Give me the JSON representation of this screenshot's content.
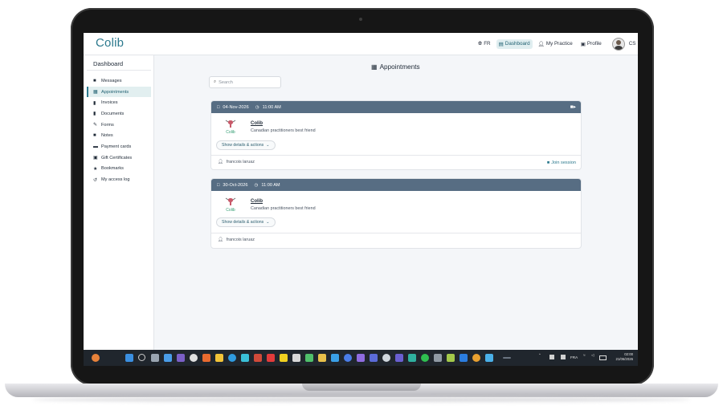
{
  "header": {
    "logo": "Colib",
    "language": "FR",
    "nav": [
      {
        "label": "Dashboard",
        "icon": "dashboard-icon",
        "active": true
      },
      {
        "label": "My Practice",
        "icon": "person-icon",
        "active": false
      },
      {
        "label": "Profile",
        "icon": "id-card-icon",
        "active": false
      }
    ],
    "user_initials": "CS"
  },
  "sidebar": {
    "title": "Dashboard",
    "items": [
      {
        "label": "Messages",
        "icon": "chat-icon"
      },
      {
        "label": "Appointments",
        "icon": "calendar-icon",
        "active": true
      },
      {
        "label": "Invoices",
        "icon": "file-icon"
      },
      {
        "label": "Documents",
        "icon": "document-icon"
      },
      {
        "label": "Forms",
        "icon": "form-icon"
      },
      {
        "label": "Notes",
        "icon": "note-icon"
      },
      {
        "label": "Payment cards",
        "icon": "credit-card-icon"
      },
      {
        "label": "Gift Certificates",
        "icon": "gift-icon"
      },
      {
        "label": "Bookmarks",
        "icon": "star-icon"
      },
      {
        "label": "My access log",
        "icon": "history-icon"
      }
    ]
  },
  "main": {
    "title": "Appointments",
    "search_placeholder": "Search",
    "appointments": [
      {
        "date": "04-Nov-2026",
        "time": "11:00 AM",
        "provider": "Colib",
        "provider_logo_text": "Colib",
        "subtitle": "Canadian practitioners best friend",
        "details_label": "Show details & actions",
        "practitioner": "francois laruaz",
        "join_label": "Join session",
        "video": true
      },
      {
        "date": "30-Oct-2026",
        "time": "11:00 AM",
        "provider": "Colib",
        "provider_logo_text": "Colib",
        "subtitle": "Canadian practitioners best friend",
        "details_label": "Show details & actions",
        "practitioner": "francois laruaz",
        "video": false
      }
    ]
  },
  "taskbar": {
    "lang": "FRA",
    "time": "02:00",
    "date": "21/06/2026"
  },
  "colors": {
    "accent": "#2d7a8e",
    "card_header": "#576d83",
    "taskbar": "#20262d"
  }
}
